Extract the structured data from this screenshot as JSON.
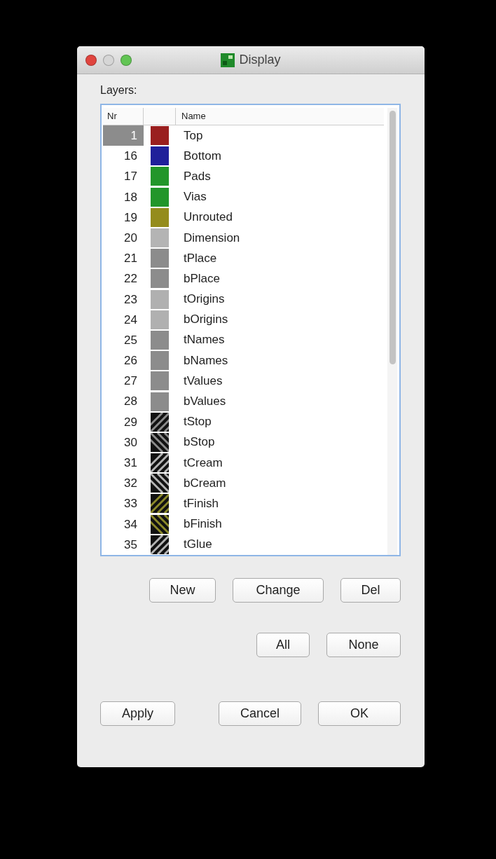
{
  "window": {
    "title": "Display"
  },
  "layers_label": "Layers:",
  "table": {
    "columns": [
      "Nr",
      "Name"
    ],
    "rows": [
      {
        "nr": "1",
        "name": "Top",
        "kind": "solid",
        "color": "#9a1f1f",
        "selected": true
      },
      {
        "nr": "16",
        "name": "Bottom",
        "kind": "solid",
        "color": "#20209a",
        "selected": false
      },
      {
        "nr": "17",
        "name": "Pads",
        "kind": "solid",
        "color": "#22962a",
        "selected": false
      },
      {
        "nr": "18",
        "name": "Vias",
        "kind": "solid",
        "color": "#22962a",
        "selected": false
      },
      {
        "nr": "19",
        "name": "Unrouted",
        "kind": "solid",
        "color": "#948c1c",
        "selected": false
      },
      {
        "nr": "20",
        "name": "Dimension",
        "kind": "solid",
        "color": "#b4b4b4",
        "selected": false
      },
      {
        "nr": "21",
        "name": "tPlace",
        "kind": "solid",
        "color": "#8c8c8c",
        "selected": false
      },
      {
        "nr": "22",
        "name": "bPlace",
        "kind": "solid",
        "color": "#8c8c8c",
        "selected": false
      },
      {
        "nr": "23",
        "name": "tOrigins",
        "kind": "solid",
        "color": "#b0b0b0",
        "selected": false
      },
      {
        "nr": "24",
        "name": "bOrigins",
        "kind": "solid",
        "color": "#b0b0b0",
        "selected": false
      },
      {
        "nr": "25",
        "name": "tNames",
        "kind": "solid",
        "color": "#8c8c8c",
        "selected": false
      },
      {
        "nr": "26",
        "name": "bNames",
        "kind": "solid",
        "color": "#8c8c8c",
        "selected": false
      },
      {
        "nr": "27",
        "name": "tValues",
        "kind": "solid",
        "color": "#8c8c8c",
        "selected": false
      },
      {
        "nr": "28",
        "name": "bValues",
        "kind": "solid",
        "color": "#8c8c8c",
        "selected": false
      },
      {
        "nr": "29",
        "name": "tStop",
        "kind": "hatch-forward",
        "color": "#8c8c8c",
        "selected": false
      },
      {
        "nr": "30",
        "name": "bStop",
        "kind": "hatch-back",
        "color": "#8c8c8c",
        "selected": false
      },
      {
        "nr": "31",
        "name": "tCream",
        "kind": "hatch-forward",
        "color": "#b4b4b4",
        "selected": false
      },
      {
        "nr": "32",
        "name": "bCream",
        "kind": "hatch-back",
        "color": "#b4b4b4",
        "selected": false
      },
      {
        "nr": "33",
        "name": "tFinish",
        "kind": "hatch-forward",
        "color": "#8c8a2a",
        "selected": false
      },
      {
        "nr": "34",
        "name": "bFinish",
        "kind": "hatch-back",
        "color": "#8c8a2a",
        "selected": false
      },
      {
        "nr": "35",
        "name": "tGlue",
        "kind": "hatch-forward",
        "color": "#b4b4b4",
        "selected": false
      }
    ]
  },
  "edit_buttons": [
    "New",
    "Change",
    "Del"
  ],
  "select_buttons": [
    "All",
    "None"
  ],
  "dialog_buttons": [
    "Apply",
    "Cancel",
    "OK"
  ]
}
